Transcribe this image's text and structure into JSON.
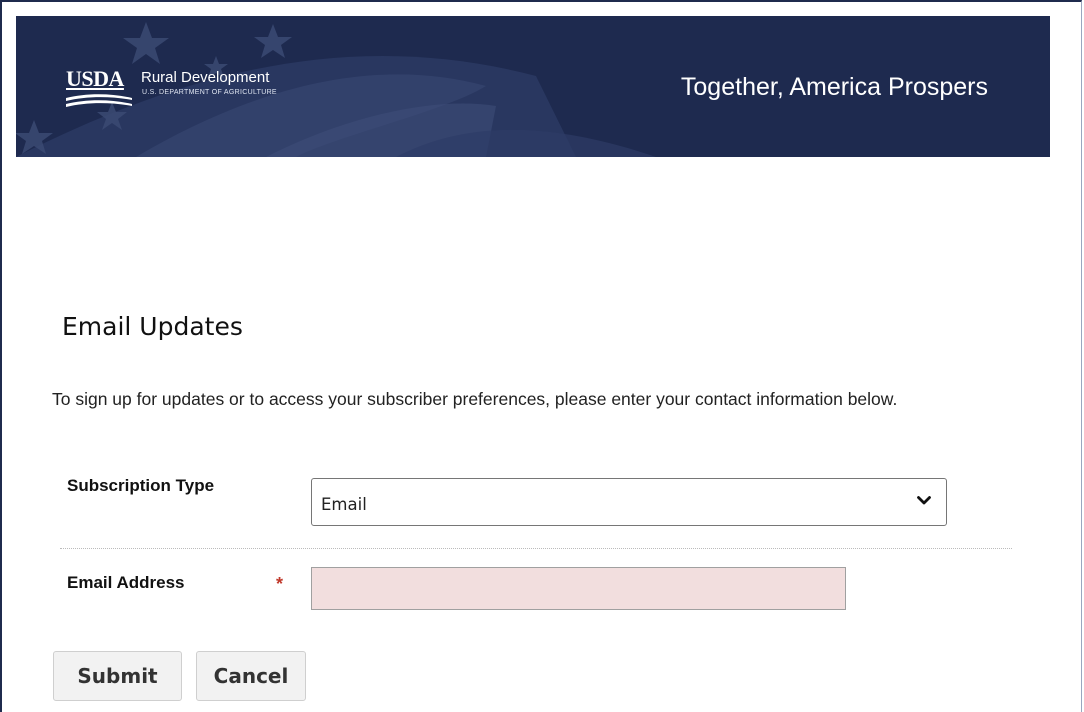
{
  "header": {
    "logo_mark": "USDA",
    "agency_name": "Rural Development",
    "department": "U.S. DEPARTMENT OF AGRICULTURE",
    "tagline": "Together, America Prospers",
    "background_color": "#1e2a4f"
  },
  "page": {
    "heading": "Email Updates",
    "intro": "To sign up for updates or to access your subscriber preferences, please enter your contact information below."
  },
  "form": {
    "subscription_type": {
      "label": "Subscription Type",
      "selected": "Email"
    },
    "email": {
      "label": "Email Address",
      "required_marker": "*",
      "value": "",
      "background_color": "#f2dede"
    },
    "buttons": {
      "submit_label": "Submit",
      "cancel_label": "Cancel"
    }
  },
  "icons": {
    "dropdown": "chevron-down-icon",
    "stars": "star-icon"
  }
}
